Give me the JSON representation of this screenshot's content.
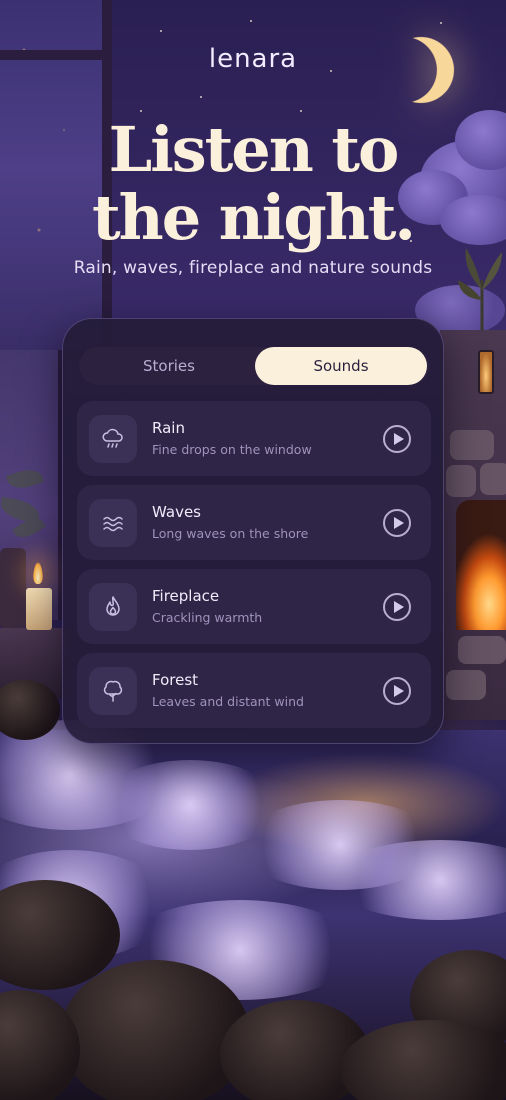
{
  "app": {
    "brand": "lenara",
    "headline_line1": "Listen to",
    "headline_line2": "the night.",
    "subheadline": "Rain, waves, fireplace and nature sounds"
  },
  "tabs": [
    {
      "label": "Stories",
      "selected": false
    },
    {
      "label": "Sounds",
      "selected": true
    }
  ],
  "sounds": [
    {
      "title": "Rain",
      "subtitle": "Fine drops on the window",
      "icon": "rain-cloud-icon"
    },
    {
      "title": "Waves",
      "subtitle": "Long waves on the shore",
      "icon": "waves-icon"
    },
    {
      "title": "Fireplace",
      "subtitle": "Crackling warmth",
      "icon": "flame-icon"
    },
    {
      "title": "Forest",
      "subtitle": "Leaves and distant wind",
      "icon": "tree-icon"
    }
  ],
  "colors": {
    "accent_cream": "#fbf0dc",
    "panel_bg": "#241c38",
    "row_bg": "#2f2546",
    "night_purple": "#2a1f52"
  }
}
